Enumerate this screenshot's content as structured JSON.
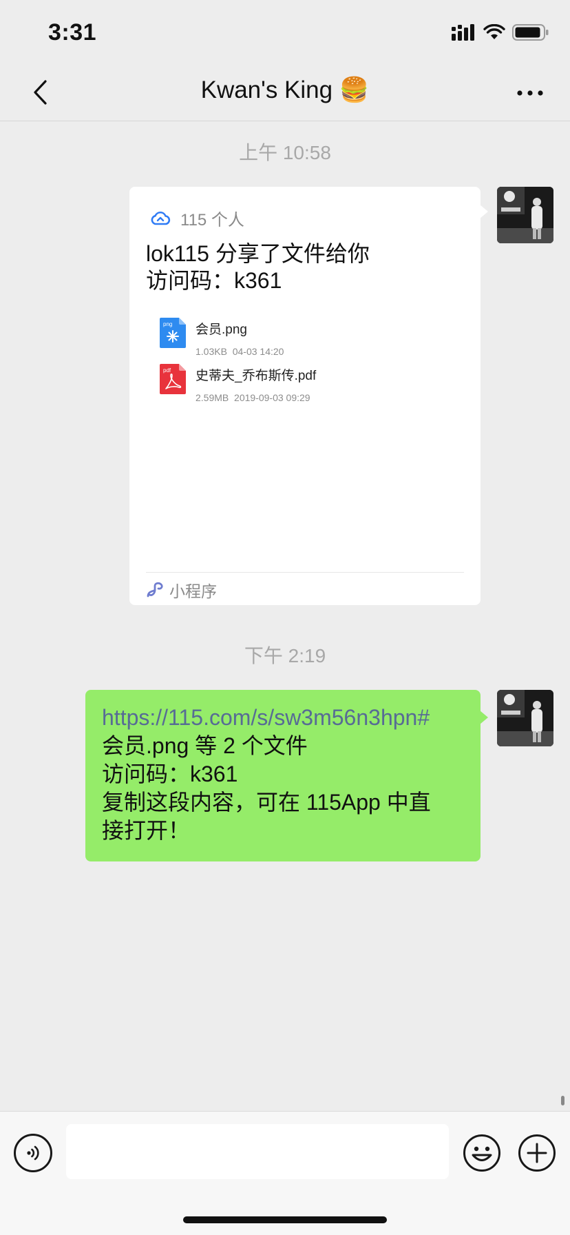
{
  "status_bar": {
    "time": "3:31",
    "icons": [
      "signal-icon",
      "wifi-icon",
      "battery-icon"
    ]
  },
  "nav": {
    "title": "Kwan's King 🍔",
    "back_icon": "chevron-left-icon",
    "more_icon": "more-dots-icon"
  },
  "messages": [
    {
      "timestamp": "上午 10:58",
      "type": "mini-program",
      "card": {
        "source": "115 个人",
        "title_line1": "lok115 分享了文件给你",
        "title_line2": "访问码：k361",
        "files": [
          {
            "name": "会员.png",
            "size": "1.03KB",
            "date": "04-03 14:20",
            "icon": "png-file-icon"
          },
          {
            "name": "史蒂夫_乔布斯传.pdf",
            "size": "2.59MB",
            "date": "2019-09-03 09:29",
            "icon": "pdf-file-icon"
          }
        ],
        "footer": "小程序"
      }
    },
    {
      "timestamp": "下午 2:19",
      "type": "text",
      "link": "https://115.com/s/sw3m56n3hpn#",
      "lines": [
        "会员.png 等 2 个文件",
        "访问码：k361",
        "复制这段内容，可在 115App 中直",
        "接打开！"
      ]
    }
  ],
  "input_bar": {
    "placeholder": "",
    "icons": [
      "voice-icon",
      "emoji-icon",
      "add-icon"
    ]
  },
  "colors": {
    "background": "#ededed",
    "bubble_green": "#95ec69",
    "link": "#576b95",
    "cloud_blue": "#2f7bf5"
  }
}
